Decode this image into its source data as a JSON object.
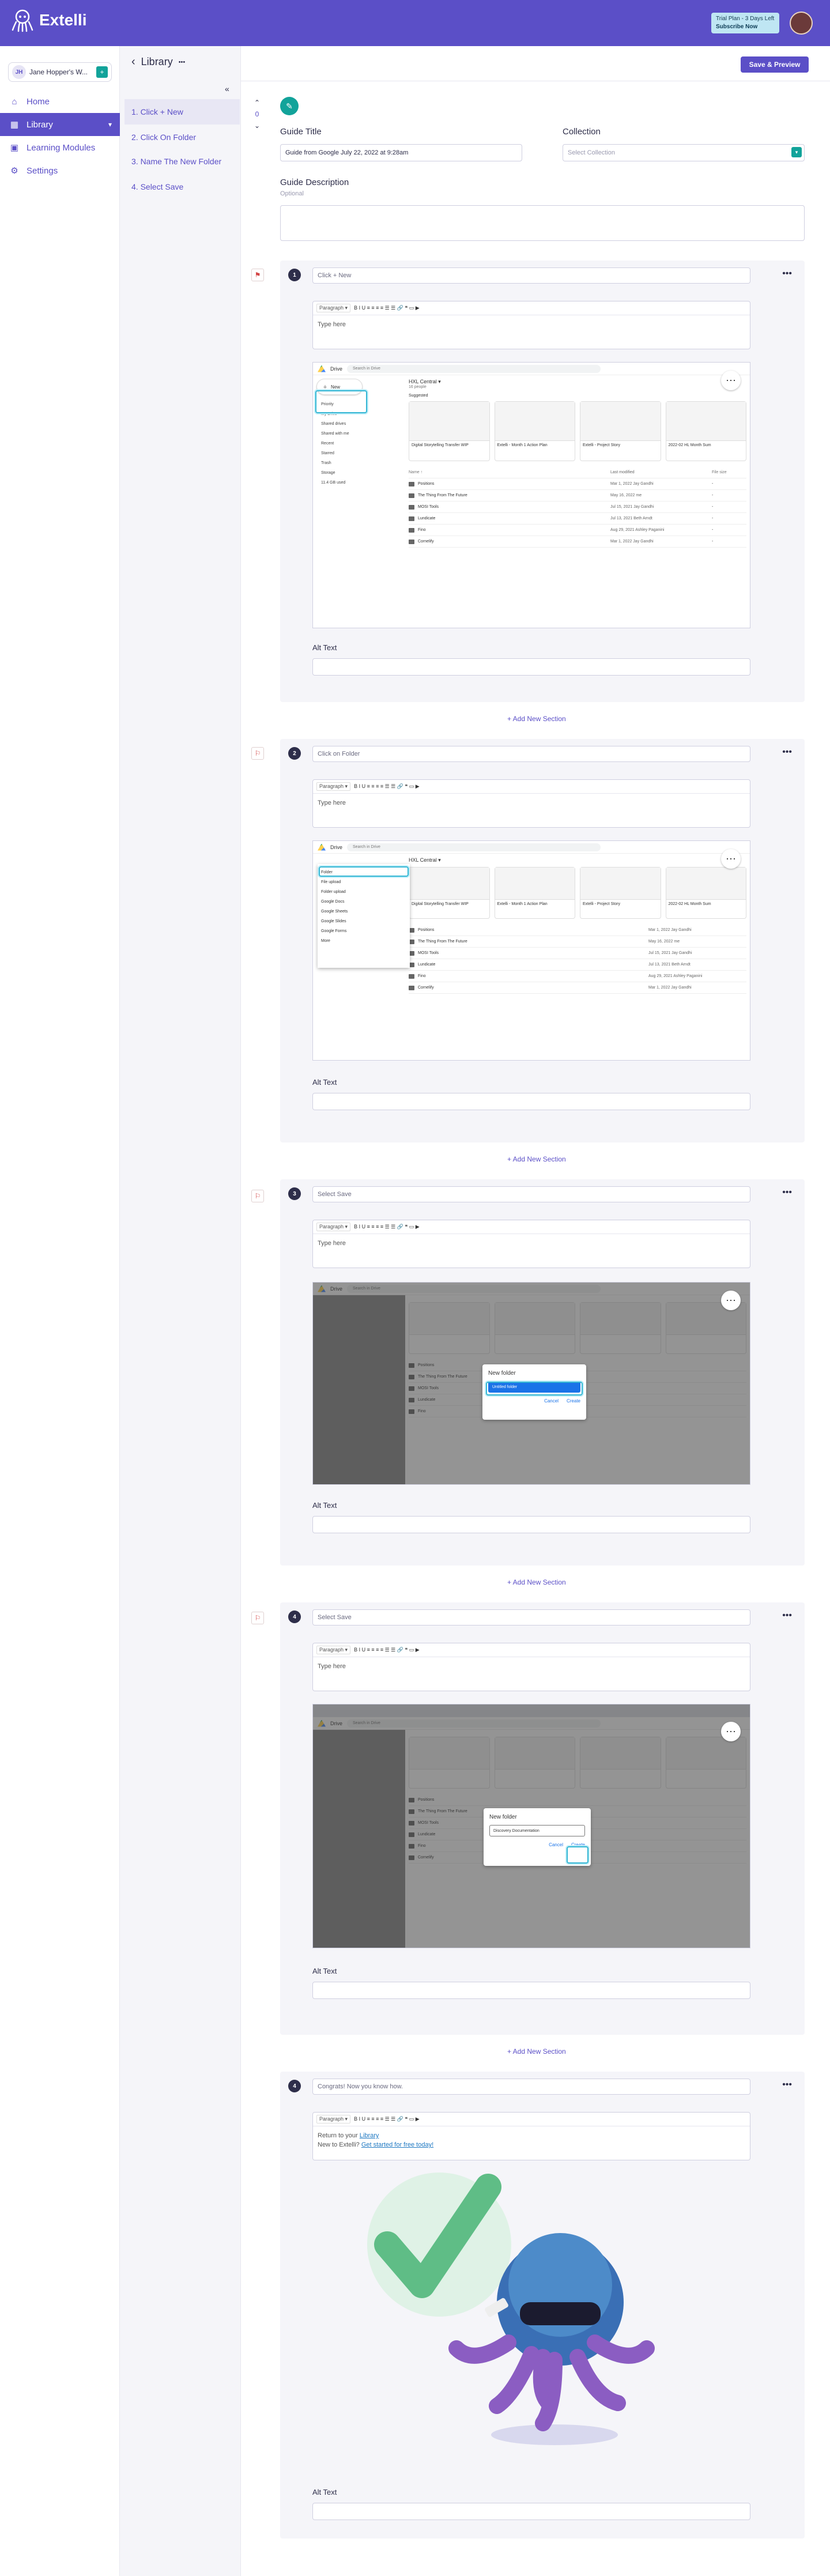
{
  "brand": {
    "name": "Extelli"
  },
  "trial": {
    "line1": "Trial Plan - 3 Days Left",
    "line2": "Subscribe Now"
  },
  "user": {
    "initials": "JH",
    "name": "Jane Hopper's W...",
    "action": "+"
  },
  "nav": [
    {
      "label": "Home",
      "icon": "⌂"
    },
    {
      "label": "Library",
      "icon": "▦"
    },
    {
      "label": "Learning Modules",
      "icon": "▣"
    },
    {
      "label": "Settings",
      "icon": "⚙"
    }
  ],
  "header": {
    "title": "Library",
    "more": "•••",
    "save_label": "Save & Preview",
    "back": "‹",
    "collapse": "«"
  },
  "steps_nav": [
    "1. Click + New",
    "2. Click On Folder",
    "3. Name The New Folder",
    "4. Select Save"
  ],
  "step_arrows": {
    "up": "⌃",
    "count": "0",
    "down": "⌄"
  },
  "guide": {
    "title_label": "Guide Title",
    "title_value": "Guide from Google July 22, 2022 at 9:28am",
    "collection_label": "Collection",
    "collection_placeholder": "Select Collection",
    "collection_btn": "▾",
    "desc_label": "Guide Description",
    "desc_sub": "Optional"
  },
  "editor": {
    "paragraph": "Paragraph ▾",
    "tools": "B  I  U  ≡  ≡  ≡  ≡  ☰  ☰  🔗  ❝  ▭  ▶",
    "placeholder": "Type here"
  },
  "drive": {
    "name": "Drive",
    "search": "Search in Drive",
    "new_label": "New",
    "nav": [
      "Priority",
      "My Drive",
      "Shared drives",
      "Shared with me",
      "Recent",
      "Starred",
      "Trash",
      "Storage",
      "11.4 GB used"
    ],
    "breadcrumb": "HXL Central ▾",
    "members": "16 people",
    "suggested": "Suggested",
    "cards": [
      "Digital Storytelling Transfer WIP",
      "Extelli - Month 1 Action Plan",
      "Extelli - Project Story",
      "2022-02 HL Month Sum"
    ],
    "columns": {
      "name": "Name ↑",
      "modified": "Last modified",
      "size": "File size"
    },
    "rows": [
      {
        "name": "Positions",
        "date": "Mar 1, 2022 Jay Gandhi"
      },
      {
        "name": "The Thing From The Future",
        "date": "May 16, 2022 me"
      },
      {
        "name": "MOSI Tools",
        "date": "Jul 15, 2021 Jay Gandhi"
      },
      {
        "name": "Lundicate",
        "date": "Jul 13, 2021 Beth Arndt"
      },
      {
        "name": "Fino",
        "date": "Aug 29, 2021 Ashley Paganini"
      },
      {
        "name": "Cornelify",
        "date": "Mar 1, 2022 Jay Gandhi"
      }
    ],
    "menu": [
      "Folder",
      "File upload",
      "Folder upload",
      "Google Docs",
      "Google Sheets",
      "Google Slides",
      "Google Forms",
      "More"
    ],
    "dialog_title": "New folder",
    "dialog_value_a": "Untitled folder",
    "dialog_value_b": "Discovery Documentation",
    "cancel": "Cancel",
    "create": "Create"
  },
  "sections": [
    {
      "num": "1",
      "title": "Click + New",
      "flag": "⚑"
    },
    {
      "num": "2",
      "title": "Click on Folder",
      "flag": "⚐"
    },
    {
      "num": "3",
      "title": "Select Save",
      "flag": "⚐"
    },
    {
      "num": "4",
      "title": "Select Save",
      "flag": "⚐"
    },
    {
      "num": "4",
      "title": "Congrats! Now you know how.",
      "flag": ""
    }
  ],
  "final_body": {
    "line1": "Return to your ",
    "link1": "Library",
    "line2": "New to Extelli? ",
    "link2": "Get started for free today!"
  },
  "alt_label": "Alt Text",
  "add_section": "+ Add New Section",
  "menu_dots": "•••",
  "colors": {
    "primary": "#5b4fc7",
    "teal": "#12a39a",
    "highlight": "#33b6d4"
  }
}
